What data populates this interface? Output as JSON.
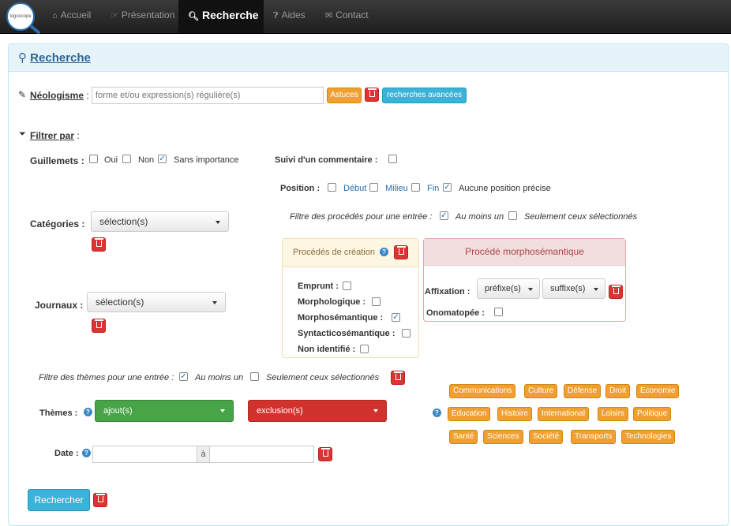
{
  "nav": {
    "logo_text": "logoscope",
    "items": [
      {
        "label": "Accueil",
        "icon": "home-icon"
      },
      {
        "label": "Présentation",
        "icon": "hand-point-icon"
      },
      {
        "label": "Recherche",
        "icon": "search-icon"
      },
      {
        "label": "Aides",
        "icon": "question-circle-icon"
      },
      {
        "label": "Contact",
        "icon": "envelope-icon"
      }
    ]
  },
  "panel": {
    "title": "Recherche"
  },
  "neologisme": {
    "label": "Néologisme",
    "colon": " :",
    "placeholder": "forme et/ou expression(s) régulière(s)",
    "astuces": "Astuces",
    "advanced": "recherches avancées"
  },
  "filtrer": {
    "label": "Filtrer par",
    "colon": " :"
  },
  "guillemets": {
    "label": "Guillemets :",
    "oui": "Oui",
    "non": "Non",
    "sans": "Sans importance"
  },
  "suivi": {
    "label": "Suivi d'un commentaire :"
  },
  "position": {
    "label": "Position :",
    "debut": "Début",
    "milieu": "Milieu",
    "fin": "Fin",
    "aucune": "Aucune position précise"
  },
  "filtre_procedes": {
    "label": "Filtre des procédés pour une entrée :",
    "au_moins": "Au moins un",
    "seulement": "Seulement ceux sélectionnés"
  },
  "categories": {
    "label": "Catégories :",
    "value": "sélection(s)"
  },
  "journaux": {
    "label": "Journaux :",
    "value": "sélection(s)"
  },
  "procedes_creation": {
    "title": "Procédés de création",
    "items": [
      "Emprunt :",
      "Morphologique :",
      "Morphosémantique :",
      "Syntacticosémantique :",
      "Non identifié :"
    ]
  },
  "procede_morpho": {
    "title": "Procédé morphosémantique",
    "affixation": "Affixation :",
    "prefixe": "préfixe(s)",
    "suffixe": "suffixe(s)",
    "onomatopee": "Onomatopée :"
  },
  "filtre_themes": {
    "label": "Filtre des thèmes pour une entrée :",
    "au_moins": "Au moins un",
    "seulement": "Seulement ceux sélectionnés"
  },
  "themes": {
    "label": "Thèmes :",
    "ajout": "ajout(s)",
    "exclusion": "exclusion(s)"
  },
  "date": {
    "label": "Date :",
    "a": "à"
  },
  "tags": [
    "Communications",
    "Culture",
    "Défense",
    "Droit",
    "Economie",
    "Education",
    "Histoire",
    "International",
    "Loisirs",
    "Politique",
    "Santé",
    "Sciences",
    "Société",
    "Transports",
    "Technologies"
  ],
  "submit": "Rechercher",
  "colors": {
    "accent": "#39b3d7",
    "warning": "#f0a030",
    "danger": "#d33333",
    "success": "#47a447"
  }
}
